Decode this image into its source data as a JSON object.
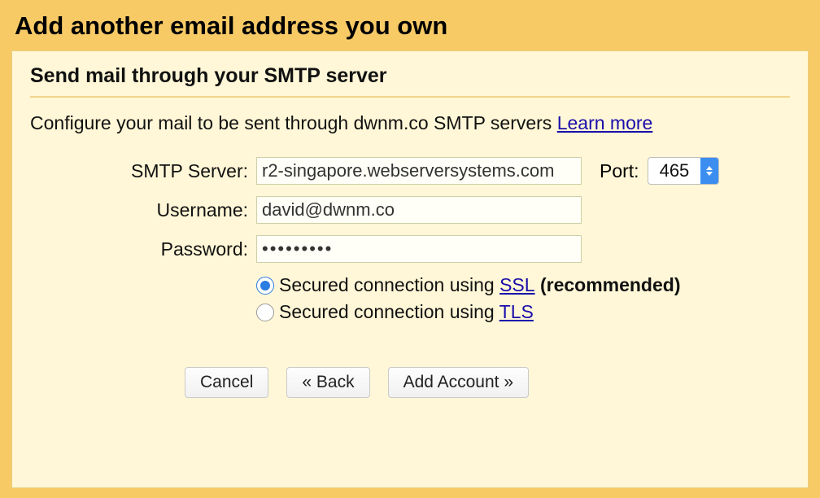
{
  "title": "Add another email address you own",
  "subtitle": "Send mail through your SMTP server",
  "description_prefix": "Configure your mail to be sent through dwnm.co SMTP servers ",
  "learn_more": "Learn more",
  "labels": {
    "smtp": "SMTP Server:",
    "port": "Port:",
    "username": "Username:",
    "password": "Password:"
  },
  "fields": {
    "smtp": "r2-singapore.webserversystems.com",
    "port": "465",
    "username": "david@dwnm.co",
    "password": "•••••••••"
  },
  "radios": {
    "ssl_prefix": "Secured connection using ",
    "ssl_link": "SSL",
    "ssl_suffix": " (recommended)",
    "tls_prefix": "Secured connection using ",
    "tls_link": "TLS"
  },
  "buttons": {
    "cancel": "Cancel",
    "back": "« Back",
    "add": "Add Account »"
  }
}
